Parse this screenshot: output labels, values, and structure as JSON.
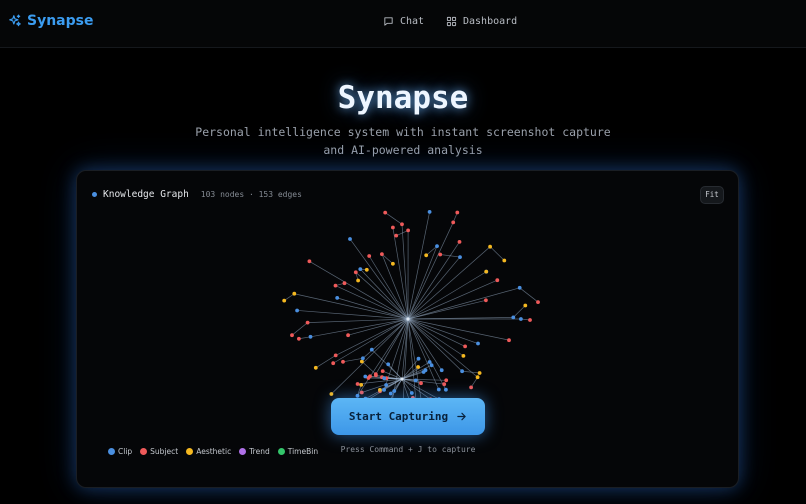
{
  "app": {
    "name": "Synapse"
  },
  "nav": {
    "chat": "Chat",
    "dashboard": "Dashboard"
  },
  "hero": {
    "title": "Synapse",
    "subtitle_line1": "Personal intelligence system with instant screenshot capture",
    "subtitle_line2": "and AI-powered analysis"
  },
  "graph": {
    "title": "Knowledge Graph",
    "stats": "103 nodes · 153 edges",
    "fit_label": "Fit",
    "legend": [
      {
        "label": "Clip",
        "color": "#4a8fe0"
      },
      {
        "label": "Subject",
        "color": "#ef5a5a"
      },
      {
        "label": "Aesthetic",
        "color": "#f5b820"
      },
      {
        "label": "Trend",
        "color": "#b071e8"
      },
      {
        "label": "TimeBin",
        "color": "#34c56b"
      }
    ]
  },
  "cta": {
    "label": "Start Capturing",
    "hint": "Press Command + J to capture"
  }
}
